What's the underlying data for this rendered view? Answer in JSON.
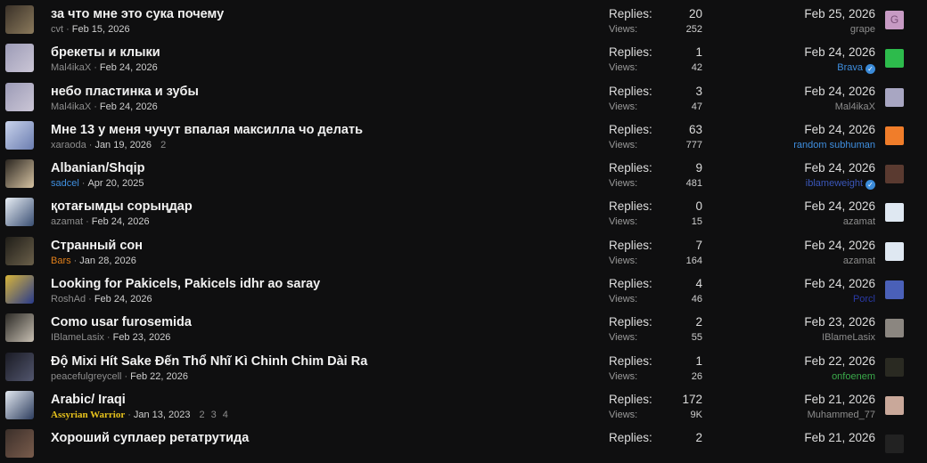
{
  "replies_label": "Replies:",
  "views_label": "Views:",
  "threads": [
    {
      "title": "за что мне это сука почему",
      "author": "cvt",
      "author_color": "#8d8d8d",
      "start_date": "Feb 15, 2026",
      "pages": [],
      "replies": "20",
      "views": "252",
      "last_date": "Feb 25, 2026",
      "last_user": "grape",
      "last_user_color": "#8d8d8d",
      "last_verified": false,
      "last_avatar_letter": "G",
      "last_avatar_bg": "#c79ac4",
      "avatar_colors": [
        "#3a3128",
        "#8b7a5c"
      ]
    },
    {
      "title": "брекеты и клыки",
      "author": "Mal4ikaX",
      "author_color": "#8d8d8d",
      "start_date": "Feb 24, 2026",
      "pages": [],
      "replies": "1",
      "views": "42",
      "last_date": "Feb 24, 2026",
      "last_user": "Brava",
      "last_user_color": "#3f8fe0",
      "last_verified": true,
      "last_avatar_letter": "",
      "last_avatar_bg": "#2dbb4c",
      "avatar_colors": [
        "#9c9bb6",
        "#cbc6d6"
      ]
    },
    {
      "title": "небо пластинка и зубы",
      "author": "Mal4ikaX",
      "author_color": "#8d8d8d",
      "start_date": "Feb 24, 2026",
      "pages": [],
      "replies": "3",
      "views": "47",
      "last_date": "Feb 24, 2026",
      "last_user": "Mal4ikaX",
      "last_user_color": "#8d8d8d",
      "last_verified": false,
      "last_avatar_letter": "",
      "last_avatar_bg": "#a8a6c2",
      "avatar_colors": [
        "#9c9bb6",
        "#cbc6d6"
      ]
    },
    {
      "title": "Мне 13 у меня чучут впалая максилла чо делать",
      "author": "xaraoda",
      "author_color": "#8d8d8d",
      "start_date": "Jan 19, 2026",
      "pages": [
        "2"
      ],
      "replies": "63",
      "views": "777",
      "last_date": "Feb 24, 2026",
      "last_user": "random subhuman",
      "last_user_color": "#3f8fe0",
      "last_verified": false,
      "last_avatar_letter": "",
      "last_avatar_bg": "#f07d2a",
      "avatar_colors": [
        "#c9d3ec",
        "#6b7db0"
      ]
    },
    {
      "title": "Albanian/Shqip",
      "author": "sadcel",
      "author_color": "#3f8fe0",
      "start_date": "Apr 20, 2025",
      "pages": [],
      "replies": "9",
      "views": "481",
      "last_date": "Feb 24, 2026",
      "last_user": "iblameweight",
      "last_user_color": "#3a56b8",
      "last_verified": true,
      "last_avatar_letter": "",
      "last_avatar_bg": "#5a3a30",
      "avatar_colors": [
        "#2a2520",
        "#d6c3a2"
      ]
    },
    {
      "title": "қотағымды сорыңдар",
      "author": "azamat",
      "author_color": "#8d8d8d",
      "start_date": "Feb 24, 2026",
      "pages": [],
      "replies": "0",
      "views": "15",
      "last_date": "Feb 24, 2026",
      "last_user": "azamat",
      "last_user_color": "#8d8d8d",
      "last_verified": false,
      "last_avatar_letter": "",
      "last_avatar_bg": "#dfe8f2",
      "avatar_colors": [
        "#e8eef5",
        "#3a4f73"
      ]
    },
    {
      "title": "Странный сон",
      "author": "Bars",
      "author_color": "#e07f1a",
      "start_date": "Jan 28, 2026",
      "pages": [],
      "replies": "7",
      "views": "164",
      "last_date": "Feb 24, 2026",
      "last_user": "azamat",
      "last_user_color": "#8d8d8d",
      "last_verified": false,
      "last_avatar_letter": "",
      "last_avatar_bg": "#dfe8f2",
      "avatar_colors": [
        "#1f1d18",
        "#6b604a"
      ]
    },
    {
      "title": "Looking for Pakicels, Pakicels idhr ao saray",
      "author": "RoshAd",
      "author_color": "#8d8d8d",
      "start_date": "Feb 24, 2026",
      "pages": [],
      "replies": "4",
      "views": "46",
      "last_date": "Feb 24, 2026",
      "last_user": "Porcl",
      "last_user_color": "#2a3aa8",
      "last_verified": false,
      "last_avatar_letter": "",
      "last_avatar_bg": "#4a60b8",
      "avatar_colors": [
        "#d8b53a",
        "#283a8c"
      ]
    },
    {
      "title": "Como usar furosemida",
      "author": "IBlameLasix",
      "author_color": "#8d8d8d",
      "start_date": "Feb 23, 2026",
      "pages": [],
      "replies": "2",
      "views": "55",
      "last_date": "Feb 23, 2026",
      "last_user": "IBlameLasix",
      "last_user_color": "#8d8d8d",
      "last_verified": false,
      "last_avatar_letter": "",
      "last_avatar_bg": "#8b8680",
      "avatar_colors": [
        "#2c2a26",
        "#c7bfb2"
      ]
    },
    {
      "title": "Độ Mixi Hít Sake Đến Thổ Nhĩ Kì Chinh Chim Dài Ra",
      "author": "peacefulgreycell",
      "author_color": "#8d8d8d",
      "start_date": "Feb 22, 2026",
      "pages": [],
      "replies": "1",
      "views": "26",
      "last_date": "Feb 22, 2026",
      "last_user": "onfoenem",
      "last_user_color": "#3aa94a",
      "last_verified": false,
      "last_avatar_letter": "",
      "last_avatar_bg": "#2a2a22",
      "avatar_colors": [
        "#1a1b24",
        "#52566e"
      ]
    },
    {
      "title": "Arabic/ Iraqi",
      "author": "Assyrian Warrior",
      "author_color": "#e8c31c",
      "start_date": "Jan 13, 2023",
      "pages": [
        "2",
        "3",
        "4"
      ],
      "replies": "172",
      "views": "9K",
      "last_date": "Feb 21, 2026",
      "last_user": "Muhammed_77",
      "last_user_color": "#8d8d8d",
      "last_verified": false,
      "last_avatar_letter": "",
      "last_avatar_bg": "#c9a89a",
      "avatar_colors": [
        "#e3e9f1",
        "#2d3d5e"
      ]
    },
    {
      "title": "Хороший суплаер ретатрутида",
      "author": "",
      "author_color": "#8d8d8d",
      "start_date": "",
      "pages": [],
      "replies": "2",
      "views": "",
      "last_date": "Feb 21, 2026",
      "last_user": "",
      "last_user_color": "#8d8d8d",
      "last_verified": false,
      "last_avatar_letter": "",
      "last_avatar_bg": "#222222",
      "avatar_colors": [
        "#3b2f2a",
        "#7a5c4c"
      ]
    }
  ]
}
